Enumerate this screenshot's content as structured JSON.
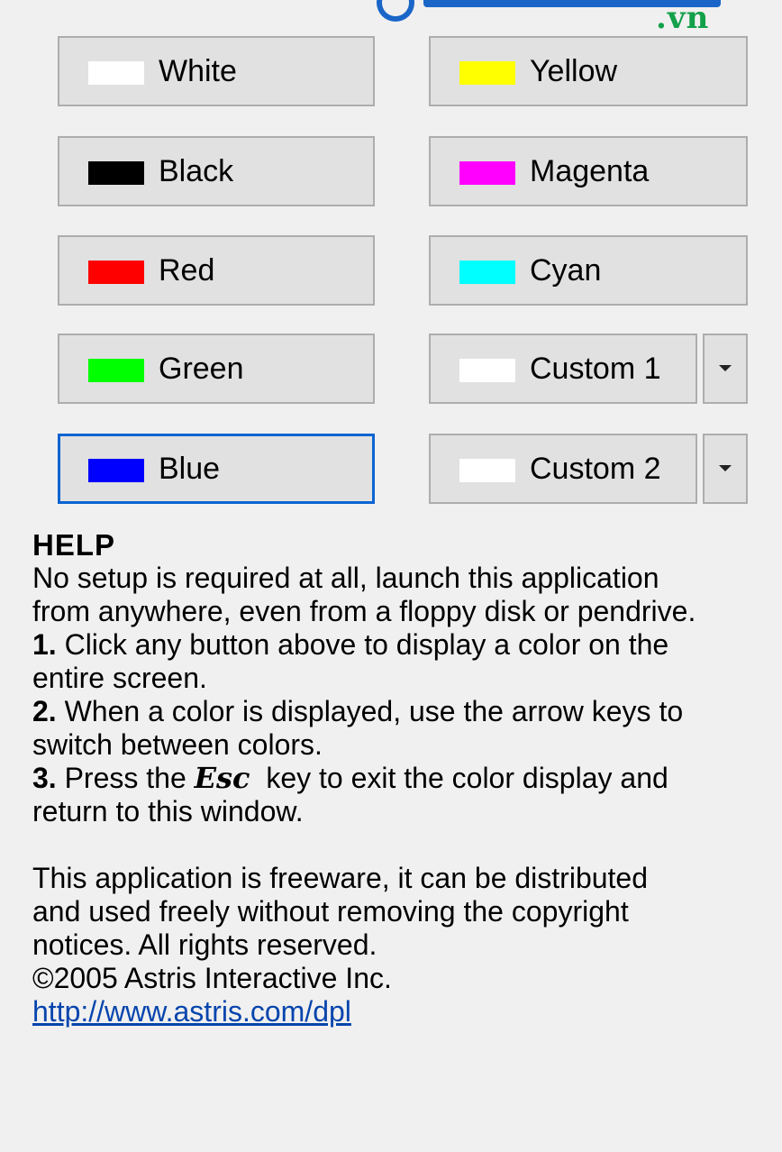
{
  "watermark": {
    "suffix": ".vn",
    "color": "#1a66c8",
    "suffix_color": "#13a04a"
  },
  "buttons": [
    {
      "name": "white",
      "label": "White",
      "color": "#ffffff"
    },
    {
      "name": "yellow",
      "label": "Yellow",
      "color": "#ffff00"
    },
    {
      "name": "black",
      "label": "Black",
      "color": "#000000"
    },
    {
      "name": "magenta",
      "label": "Magenta",
      "color": "#ff00ff"
    },
    {
      "name": "red",
      "label": "Red",
      "color": "#ff0000"
    },
    {
      "name": "cyan",
      "label": "Cyan",
      "color": "#00ffff"
    },
    {
      "name": "green",
      "label": "Green",
      "color": "#00ff00"
    },
    {
      "name": "custom1",
      "label": "Custom 1",
      "color": "#ffffff"
    },
    {
      "name": "blue",
      "label": "Blue",
      "color": "#0000ff"
    },
    {
      "name": "custom2",
      "label": "Custom 2",
      "color": "#ffffff"
    }
  ],
  "help": {
    "title": "HELP",
    "intro_line1": "No setup is required at all, launch this application",
    "intro_line2": "from anywhere, even from a floppy disk or pendrive.",
    "step1_num": "1.",
    "step1_line1": " Click any button above to display a color on the",
    "step1_line2": "entire screen.",
    "step2_num": "2.",
    "step2_line1": " When a color is displayed, use the arrow keys to",
    "step2_line2": "switch between colors.",
    "step3_num": "3.",
    "step3_pre": " Press the ",
    "step3_key": "Esc",
    "step3_post": "  key to exit the color display and",
    "step3_line2": "return to this window.",
    "free_line1": "This application is freeware, it can be distributed",
    "free_line2": "and used freely without removing the copyright",
    "free_line3": "notices. All rights reserved.",
    "copyright": "©2005 Astris Interactive Inc.",
    "url": "http://www.astris.com/dpl"
  }
}
